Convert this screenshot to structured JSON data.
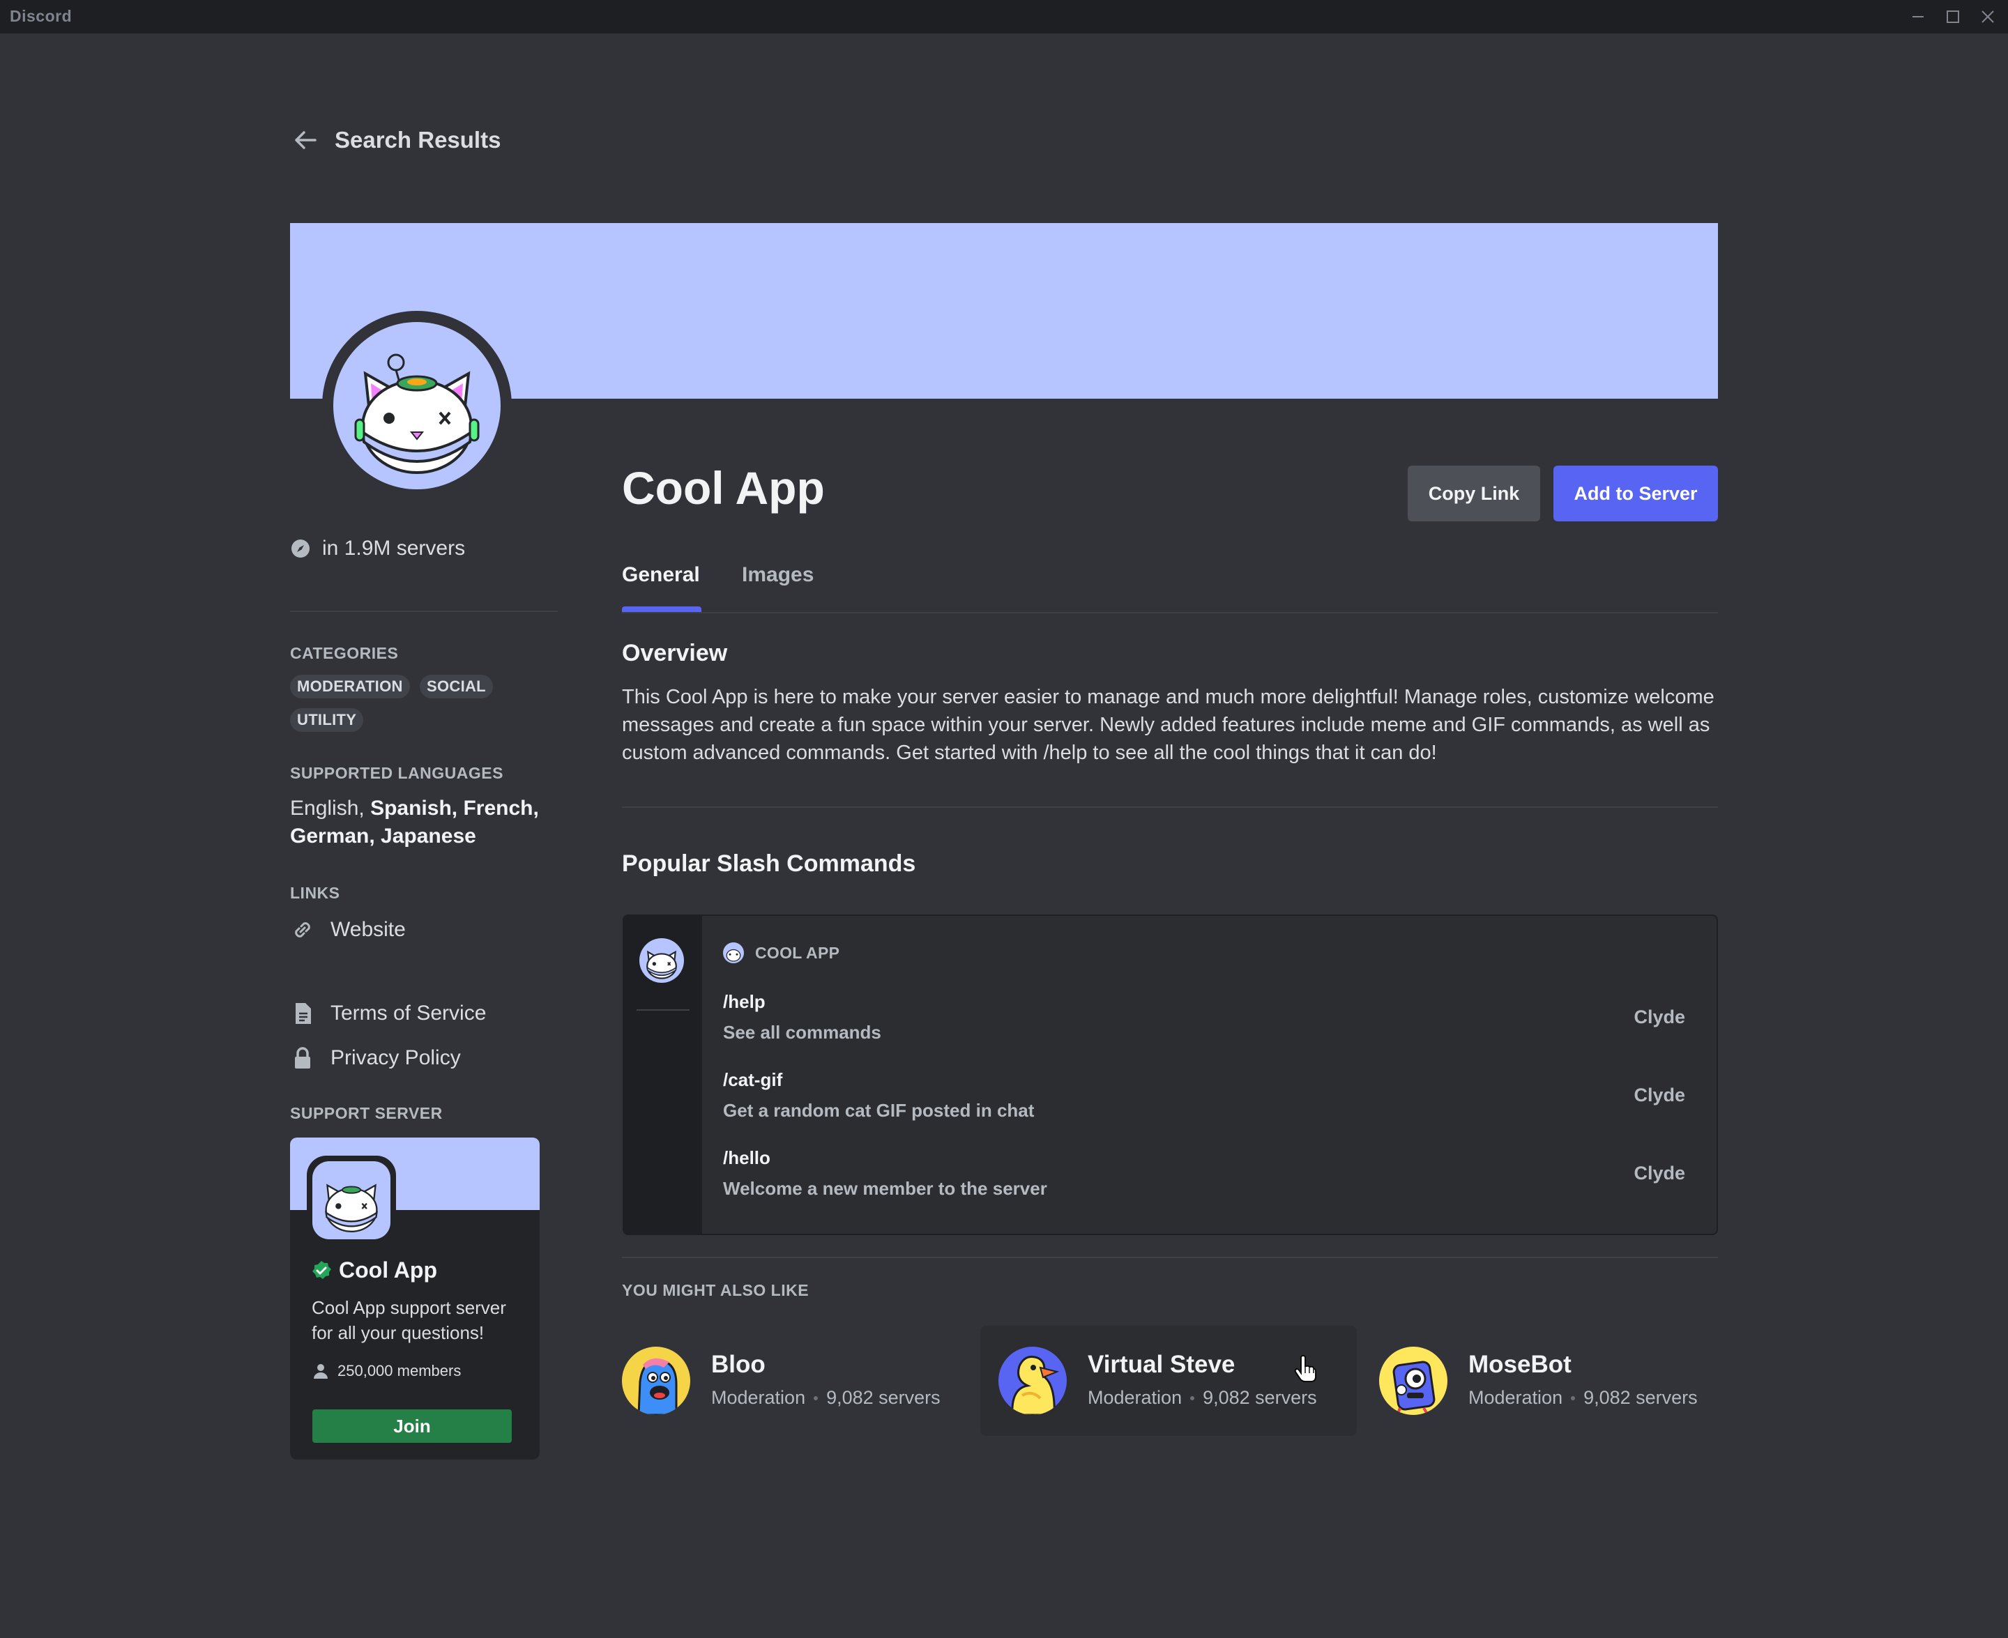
{
  "window": {
    "title": "Discord"
  },
  "nav": {
    "back_label": "Search Results"
  },
  "app": {
    "name": "Cool App",
    "server_count": "in 1.9M servers",
    "copy_link_label": "Copy Link",
    "add_to_server_label": "Add to Server"
  },
  "tabs": [
    {
      "label": "General",
      "active": true
    },
    {
      "label": "Images",
      "active": false
    }
  ],
  "sidebar": {
    "categories_header": "CATEGORIES",
    "categories": [
      "MODERATION",
      "SOCIAL",
      "UTILITY"
    ],
    "languages_header": "SUPPORTED LANGUAGES",
    "languages_first": "English, ",
    "languages_rest": "Spanish, French, German, Japanese",
    "links_header": "LINKS",
    "website_label": "Website",
    "tos_label": "Terms of Service",
    "privacy_label": "Privacy Policy",
    "support_header": "SUPPORT SERVER",
    "support": {
      "name": "Cool App",
      "description": "Cool App support server for all your questions!",
      "members": "250,000 members",
      "join_label": "Join"
    }
  },
  "overview": {
    "heading": "Overview",
    "text": "This Cool App is here to make your server easier to manage and much more delightful! Manage roles, customize welcome messages and create a fun space within your server. Newly added features include meme and GIF commands, as well as custom advanced commands. Get started with /help to see all the cool things that it can do!"
  },
  "commands": {
    "heading": "Popular Slash Commands",
    "app_label": "COOL APP",
    "items": [
      {
        "name": "/help",
        "description": "See all commands",
        "owner": "Clyde"
      },
      {
        "name": "/cat-gif",
        "description": "Get a random cat GIF posted in chat",
        "owner": "Clyde"
      },
      {
        "name": "/hello",
        "description": "Welcome a new member to the server",
        "owner": "Clyde"
      }
    ]
  },
  "recommendations": {
    "heading": "YOU MIGHT ALSO LIKE",
    "items": [
      {
        "name": "Bloo",
        "category": "Moderation",
        "servers": "9,082 servers"
      },
      {
        "name": "Virtual Steve",
        "category": "Moderation",
        "servers": "9,082 servers"
      },
      {
        "name": "MoseBot",
        "category": "Moderation",
        "servers": "9,082 servers"
      }
    ]
  },
  "colors": {
    "background": "#313338",
    "titlebar": "#1e1f22",
    "banner": "#b6c5ff",
    "brand_blurple": "#5865f2",
    "join_green": "#248046",
    "secondary_button": "#4e5058"
  }
}
